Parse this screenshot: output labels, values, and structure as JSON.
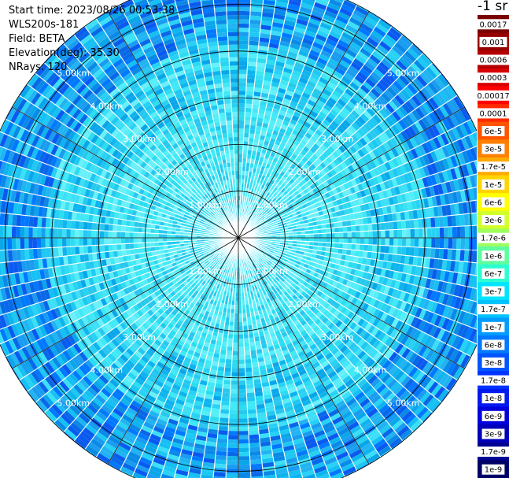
{
  "header": {
    "start_time": "Start time: 2023/08/26 00:53:38",
    "instrument": "WLS200s-181",
    "field": "Field: BETA",
    "elevation": "Elevation(deg): 35.30",
    "nrays": "NRays: 120"
  },
  "chart_data": {
    "type": "heatmap",
    "projection": "polar-ppi",
    "field": "BETA",
    "n_rays": 120,
    "range_rings_km": [
      1,
      2,
      3,
      4,
      5
    ],
    "ring_label_format": "{v}.00km",
    "max_range_km": 5.6,
    "spoke_count": 12,
    "colorbar": {
      "unit_label": "-1 sr",
      "labels": [
        "0.0017",
        "0.001",
        "0.0006",
        "0.0003",
        "0.00017",
        "0.0001",
        "6e-5",
        "3e-5",
        "1.7e-5",
        "1e-5",
        "6e-6",
        "3e-6",
        "1.7e-6",
        "1e-6",
        "6e-7",
        "3e-7",
        "1.7e-7",
        "1e-7",
        "6e-8",
        "3e-8",
        "1.7e-8",
        "1e-8",
        "6e-9",
        "3e-9",
        "1.7e-9",
        "1e-9"
      ],
      "colors": [
        "#7a0000",
        "#960000",
        "#b40000",
        "#d80000",
        "#ff0000",
        "#ff2a00",
        "#ff5500",
        "#ff8000",
        "#ffaa00",
        "#ffd400",
        "#ffff00",
        "#d2ff2a",
        "#9eff5e",
        "#5eff9e",
        "#2effd0",
        "#00e5ff",
        "#00c2ff",
        "#009cff",
        "#0078ff",
        "#0055ff",
        "#0033ff",
        "#0019f0",
        "#0000dc",
        "#0000b8",
        "#000092",
        "#000066"
      ]
    }
  }
}
